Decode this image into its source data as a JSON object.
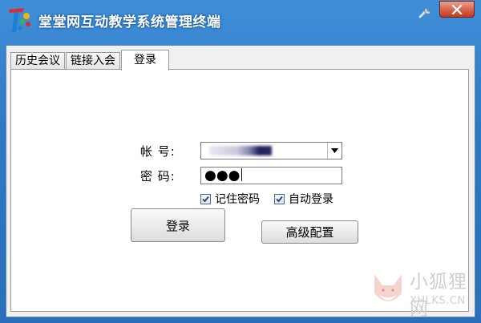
{
  "window": {
    "title": "堂堂网互动教学系统管理终端",
    "icons": {
      "wrench": "wrench-icon",
      "close": "close-icon",
      "logo": "app-logo-icon"
    }
  },
  "tabs": [
    {
      "label": "历史会议",
      "active": false
    },
    {
      "label": "链接入会",
      "active": false
    },
    {
      "label": "登录",
      "active": true
    }
  ],
  "form": {
    "account_label": "帐  号:",
    "password_label": "密  码:",
    "password_mask": "●●●",
    "remember_password_label": "记住密码",
    "remember_password_checked": true,
    "auto_login_label": "自动登录",
    "auto_login_checked": true
  },
  "buttons": {
    "login": "登录",
    "advanced": "高级配置"
  },
  "watermark": {
    "cn": "小狐狸网",
    "en": "XHLKS.CN"
  },
  "colors": {
    "titlebar": "#2f78c6",
    "close": "#c23b22"
  }
}
